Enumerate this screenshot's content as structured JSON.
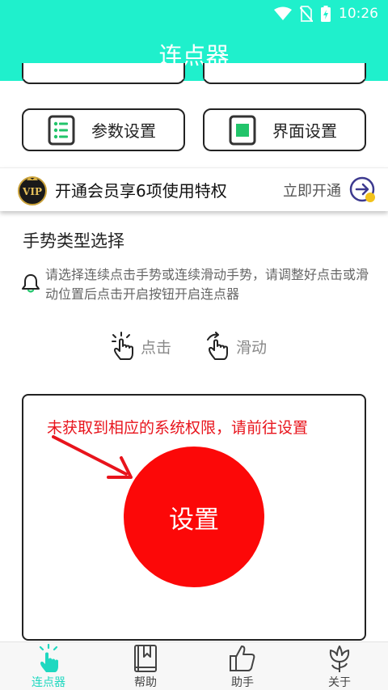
{
  "status": {
    "time": "10:26"
  },
  "header": {
    "title": "连点器"
  },
  "buttons": {
    "params": "参数设置",
    "interface": "界面设置"
  },
  "vip": {
    "badge": "VIP",
    "text": "开通会员享6项使用特权",
    "action": "立即开通"
  },
  "gesture_section": {
    "title": "手势类型选择",
    "hint": "请选择连续点击手势或连续滑动手势，请调整好点击或滑动位置后点击开启按钮开启连点器",
    "options": {
      "click": "点击",
      "slide": "滑动"
    }
  },
  "panel": {
    "permission_message": "未获取到相应的系统权限，请前往设置",
    "settings_button": "设置"
  },
  "nav": {
    "items": [
      {
        "label": "连点器",
        "icon": "tap-hand-icon"
      },
      {
        "label": "帮助",
        "icon": "book-icon"
      },
      {
        "label": "助手",
        "icon": "thumbs-up-icon"
      },
      {
        "label": "关于",
        "icon": "flower-icon"
      }
    ]
  },
  "colors": {
    "accent": "#1ff0cc",
    "alert_red": "#fc0808",
    "message_red": "#e8141c"
  }
}
